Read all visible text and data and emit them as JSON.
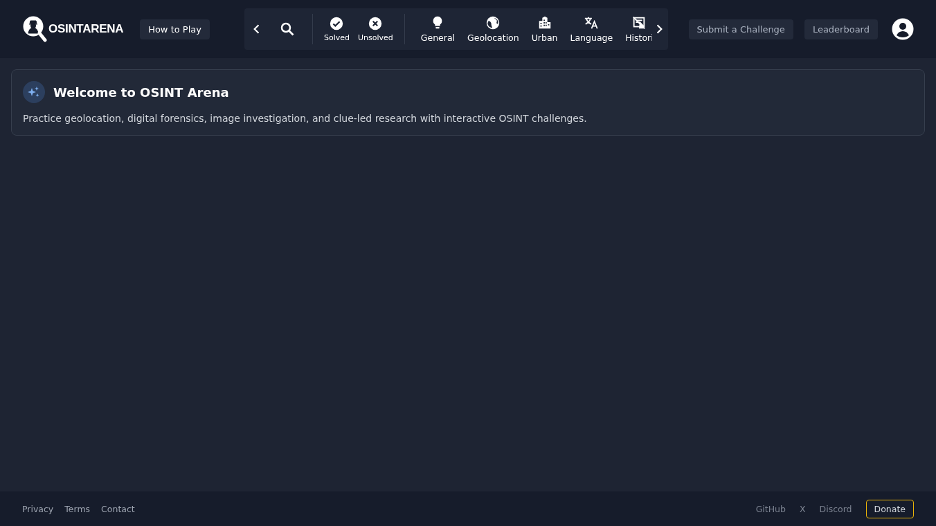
{
  "header": {
    "logo": "OSINTARENA",
    "how_to_play": "How to Play",
    "status_filters": [
      {
        "kind": "solved",
        "label": "Solved"
      },
      {
        "kind": "unsolved",
        "label": "Unsolved"
      }
    ],
    "categories": [
      {
        "kind": "general",
        "label": "General"
      },
      {
        "kind": "geolocation",
        "label": "Geolocation"
      },
      {
        "kind": "urban",
        "label": "Urban"
      },
      {
        "kind": "language",
        "label": "Language"
      },
      {
        "kind": "historic",
        "label": "Histori"
      }
    ],
    "actions": [
      "Submit a Challenge",
      "Leaderboard"
    ]
  },
  "welcome": {
    "title": "Welcome to OSINT Arena",
    "text": "Practice geolocation, digital forensics, image investigation, and clue-led research with interactive OSINT challenges."
  },
  "footer": {
    "links": [
      "Privacy",
      "Terms",
      "Contact"
    ],
    "social": [
      "GitHub",
      "X",
      "Discord"
    ],
    "donate": "Donate"
  }
}
